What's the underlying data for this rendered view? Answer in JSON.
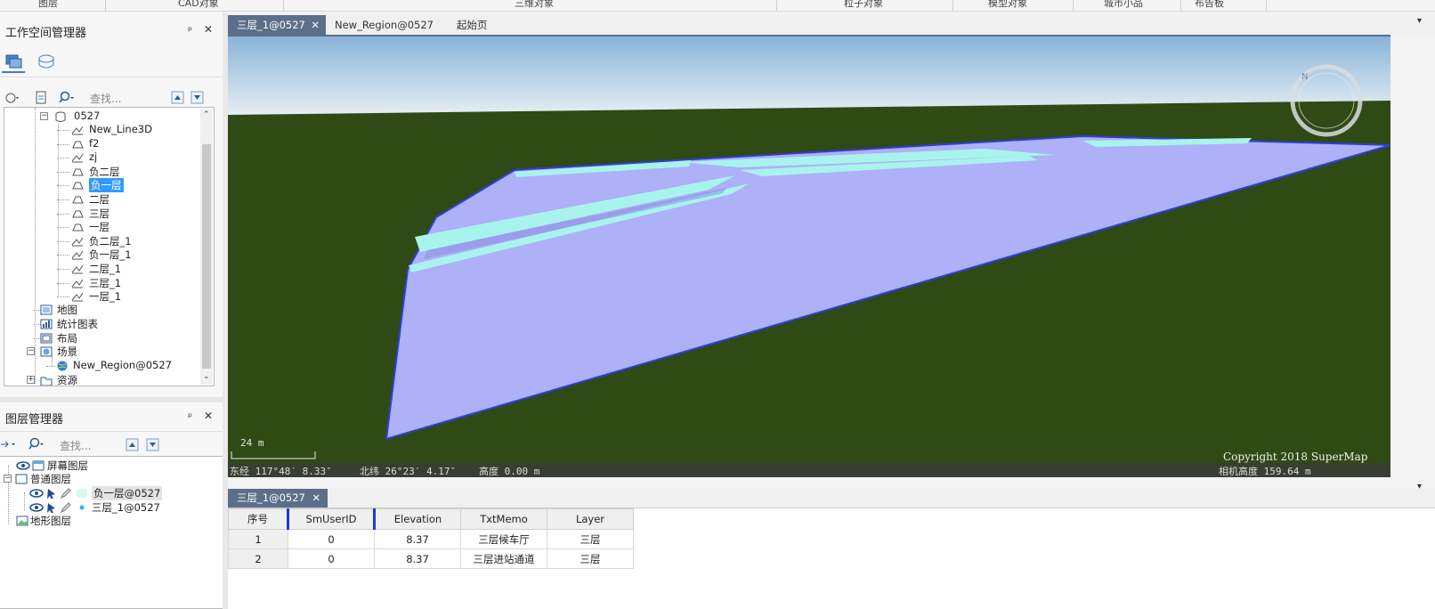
{
  "ribbon": {
    "groups": [
      "图层",
      "CAD对象",
      "三维对象",
      "粒子对象",
      "模型对象",
      "城市小品",
      "布告板"
    ]
  },
  "workspace_panel": {
    "title": "工作空间管理器",
    "pin": "ᵖ",
    "close": "✕",
    "search_placeholder": "查找...",
    "tree": {
      "datasource": "0527",
      "datasets": [
        "New_Line3D",
        "f2",
        "zj",
        "负二层",
        "负一层",
        "二层",
        "三层",
        "一层",
        "负二层_1",
        "负一层_1",
        "二层_1",
        "三层_1",
        "一层_1"
      ],
      "selected_dataset": "负一层",
      "nodes": {
        "maps": "地图",
        "charts": "统计图表",
        "layouts": "布局",
        "scenes": "场景",
        "scene_child": "New_Region@0527",
        "resources": "资源"
      },
      "expand_minus": "−",
      "expand_plus": "+"
    }
  },
  "layer_panel": {
    "title": "图层管理器",
    "pin": "ᵖ",
    "close": "✕",
    "search_placeholder": "查找...",
    "nodes": {
      "screen_layers": "屏幕图层",
      "normal_layers": "普通图层",
      "layer1": "负一层@0527",
      "layer2": "三层_1@0527",
      "terrain_layers": "地形图层"
    }
  },
  "doc_tabs": [
    {
      "label": "三层_1@0527",
      "close": "✕",
      "active": true
    },
    {
      "label": "New_Region@0527",
      "active": false
    },
    {
      "label": "起始页",
      "active": false
    }
  ],
  "scene": {
    "scale_label": "24 m",
    "copyright": "Copyright 2018 SuperMap",
    "compass_letter": "N",
    "status": {
      "longitude": "东经 117°48′ 8.33″",
      "latitude": "北纬 26°23′ 4.17″",
      "height": "高度 0.00 m",
      "camera_height": "相机高度 159.64 m"
    },
    "colors": {
      "sky_top": "#89b4d8",
      "sky_bottom": "#e8f0f4",
      "ground": "#2f4a14",
      "floor": "#aeb0f8",
      "corridor": "#a8f4ec"
    }
  },
  "attr_table": {
    "tab_label": "三层_1@0527",
    "tab_close": "✕",
    "headers": [
      "序号",
      "SmUserID",
      "Elevation",
      "TxtMemo",
      "Layer"
    ],
    "rows": [
      [
        "1",
        "0",
        "8.37",
        "三层候车厅",
        "三层"
      ],
      [
        "2",
        "0",
        "8.37",
        "三层进站通道",
        "三层"
      ]
    ]
  }
}
